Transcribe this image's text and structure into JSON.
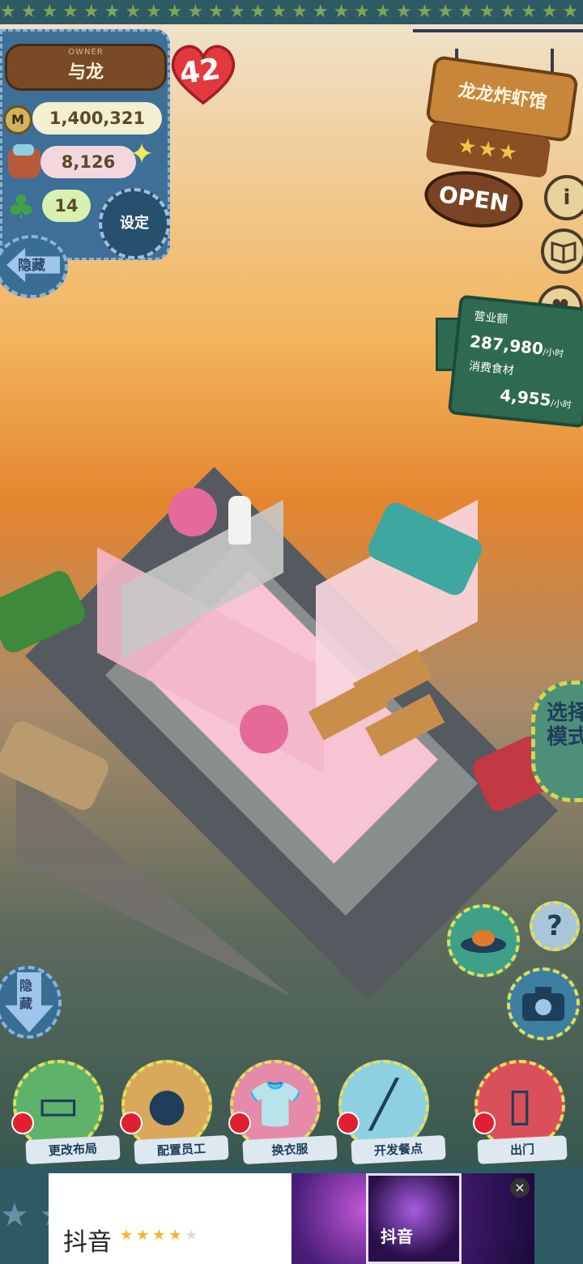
{
  "owner": {
    "tag": "OWNER",
    "name": "与龙",
    "level": "42"
  },
  "stats": {
    "money": "1,400,321",
    "food": "8,126",
    "clover": "14"
  },
  "buttons": {
    "settings": "设定",
    "hide_top": "隐藏",
    "hide_bottom": "隐藏",
    "mode": "选择模式"
  },
  "shop": {
    "name": "龙龙炸虾馆",
    "status": "OPEN",
    "rating": "★★★"
  },
  "revenue": {
    "revenue_label": "营业额",
    "revenue_value": "287,980",
    "revenue_unit": "/小时",
    "food_label": "消费食材",
    "food_value": "4,955",
    "food_unit": "/小时"
  },
  "side_icons": [
    "i",
    "♥"
  ],
  "help_icon": "?",
  "actions": [
    {
      "label": "更改布局",
      "icon": "table-icon",
      "color": "#5fb26a"
    },
    {
      "label": "配置员工",
      "icon": "bear-icon",
      "color": "#d9a85a"
    },
    {
      "label": "换衣服",
      "icon": "shirt-icon",
      "color": "#e58aa8"
    },
    {
      "label": "开发餐点",
      "icon": "knife-icon",
      "color": "#8fd0e0"
    },
    {
      "label": "出门",
      "icon": "door-icon",
      "color": "#d9505a"
    }
  ],
  "ad": {
    "title": "抖音",
    "logo": "抖音",
    "rating_stars": "★★★★",
    "rating_empty": "★",
    "close": "×"
  }
}
